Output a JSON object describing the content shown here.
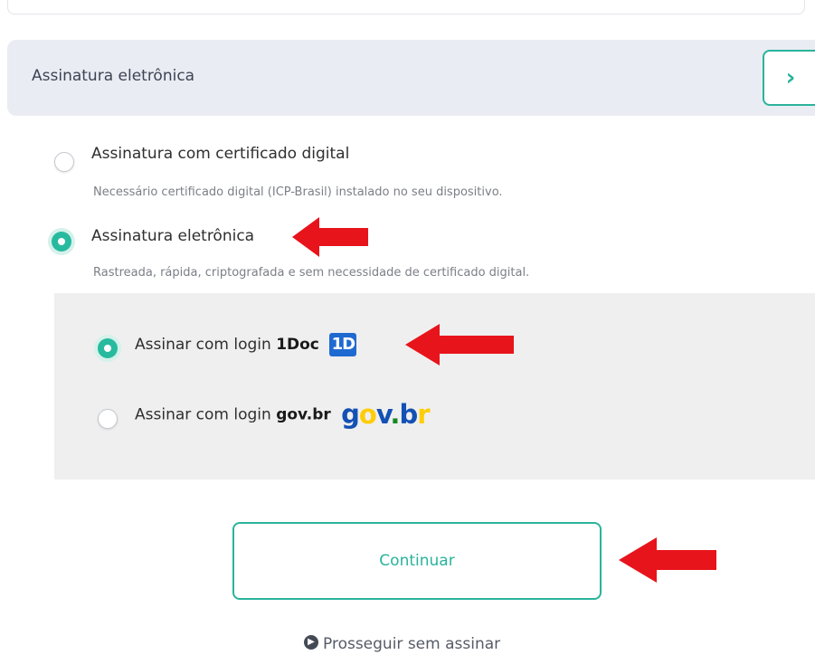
{
  "section": {
    "title": "Assinatura eletrônica",
    "expand_icon": "chevron-right-icon"
  },
  "options": [
    {
      "label": "Assinatura com certificado digital",
      "description": "Necessário certificado digital (ICP-Brasil) instalado no seu dispositivo.",
      "selected": false
    },
    {
      "label": "Assinatura eletrônica",
      "description": "Rastreada, rápida, criptografada e sem necessidade de certificado digital.",
      "selected": true
    }
  ],
  "login_options": [
    {
      "prefix": "Assinar com login",
      "brand": "1Doc",
      "logo_text": "1D",
      "selected": true
    },
    {
      "prefix": "Assinar com login",
      "brand": "gov.br",
      "logo_parts": [
        "g",
        "o",
        "v",
        ".",
        "b",
        "r"
      ],
      "selected": false
    }
  ],
  "actions": {
    "continue_label": "Continuar",
    "proceed_label": "Prosseguir sem assinar"
  },
  "colors": {
    "accent": "#2ab39c",
    "annotation_arrow": "#e8141b",
    "header_bg": "#e9ecf3",
    "panel_bg": "#efefef"
  }
}
